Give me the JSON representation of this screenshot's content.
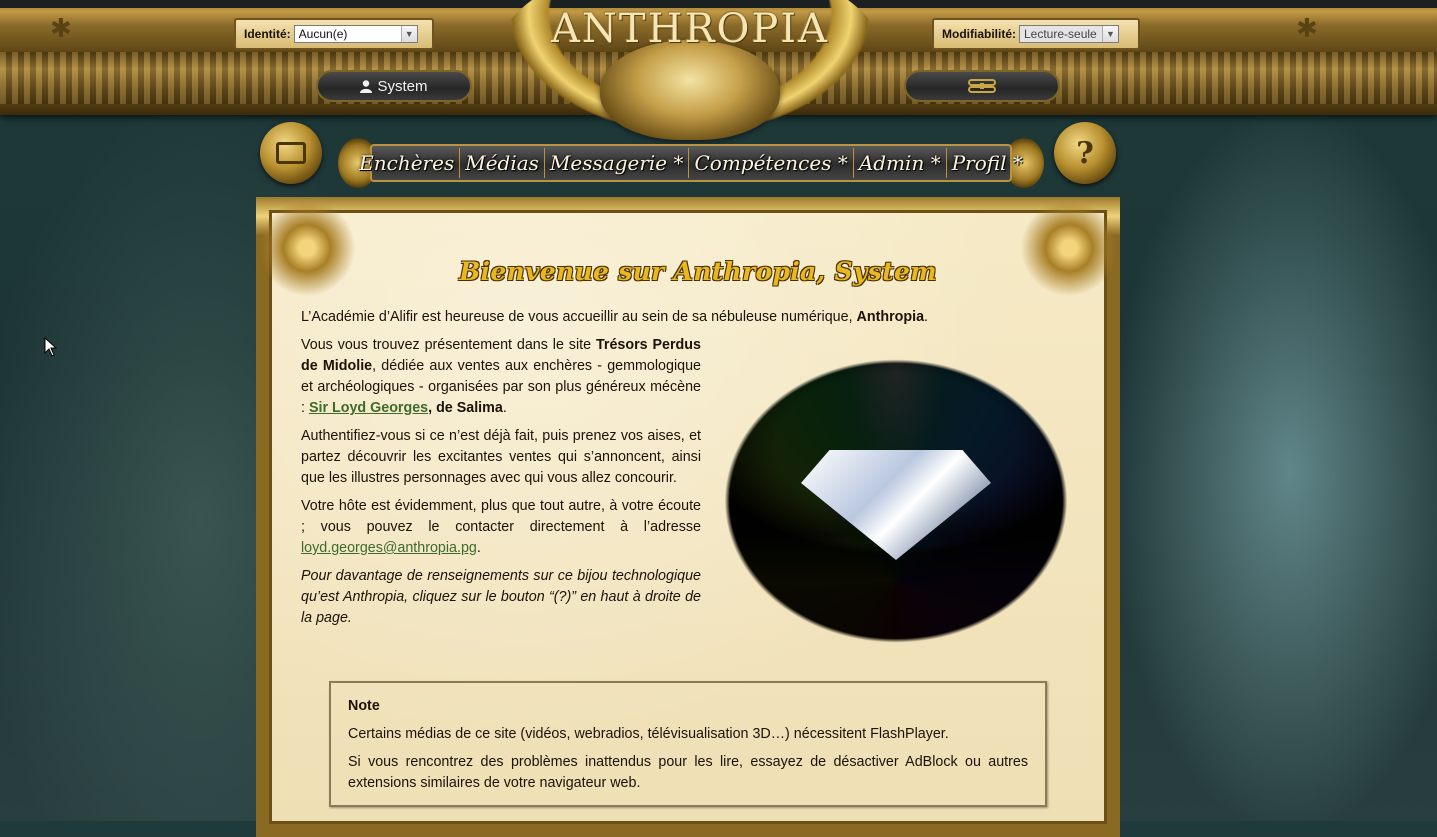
{
  "header": {
    "logo_text": "ANTHROPIA",
    "identity_label": "Identité:",
    "identity_value": "Aucun(e)",
    "modif_label": "Modifiabilité:",
    "modif_value": "Lecture-seule",
    "user_name": "System",
    "user_icon": "user-icon",
    "right_pill_icon": "link-icon"
  },
  "nav": {
    "items": [
      {
        "label": "Enchères"
      },
      {
        "label": "Médias"
      },
      {
        "label": "Messagerie *"
      },
      {
        "label": "Compétences *"
      },
      {
        "label": "Admin *"
      },
      {
        "label": "Profil *"
      }
    ],
    "help_glyph": "?"
  },
  "main": {
    "welcome_title": "Bienvenue sur Anthropia, System",
    "intro": {
      "text": "L’Académie d’Alifir est heureuse de vous accueillir au sein de sa nébuleuse numérique, ",
      "bold": "Anthropia",
      "end": "."
    },
    "p1": {
      "a": "Vous vous trouvez présentement dans le site ",
      "site": "Trésors Perdus de Midolie",
      "b": ", dédiée aux ventes aux enchères - gemmologique et archéologiques - organisées par son plus généreux mécène : ",
      "link": "Sir Loyd Georges",
      "c": ", de Salima",
      "d": "."
    },
    "p2": "Authentifiez-vous si ce n’est déjà fait, puis prenez vos aises, et partez découvrir les excitantes ventes qui s’annoncent, ainsi que les illustres personnages avec qui vous allez concourir.",
    "p3": {
      "a": "Votre hôte est évidemment, plus que tout autre, à votre écoute ; vous pouvez le contacter directement à l’adresse ",
      "email": "loyd.georges@anthropia.pg",
      "b": "."
    },
    "p4": "Pour davantage de renseignements sur ce bijou technologique qu’est Anthropia, cliquez sur le bouton “(?)” en haut à droite de la page.",
    "note": {
      "title": "Note",
      "line1": "Certains médias de ce site (vidéos, webradios, télévisualisation 3D…) nécessitent FlashPlayer.",
      "line2": "Si vous rencontrez des problèmes inattendus pour les lire, essayez de désactiver AdBlock ou autres extensions similaires de votre navigateur web."
    }
  },
  "colors": {
    "gold": "#b89441",
    "parchment": "#f3e6bf",
    "link_green": "#3f6b2a",
    "title_gold": "#e9b81f"
  }
}
